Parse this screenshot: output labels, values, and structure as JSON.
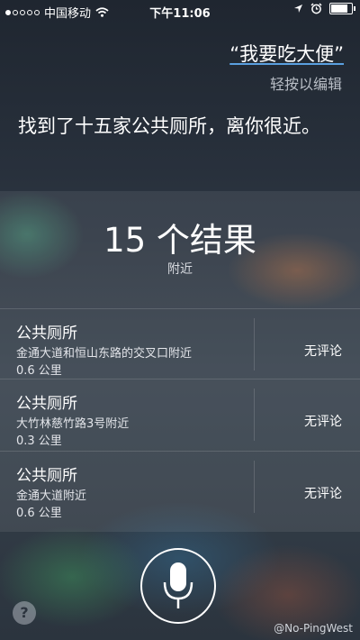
{
  "status_bar": {
    "carrier": "中国移动",
    "time": "下午11:06"
  },
  "siri": {
    "query": "“我要吃大便”",
    "tap_to_edit": "轻按以编辑",
    "answer": "找到了十五家公共厕所，离你很近。"
  },
  "results": {
    "count_label": "15 个结果",
    "subtitle": "附近",
    "items": [
      {
        "name": "公共厕所",
        "address": "金通大道和恒山东路的交叉口附近",
        "distance": "0.6 公里",
        "reviews": "无评论"
      },
      {
        "name": "公共厕所",
        "address": "大竹林慈竹路3号附近",
        "distance": "0.3 公里",
        "reviews": "无评论"
      },
      {
        "name": "公共厕所",
        "address": "金通大道附近",
        "distance": "0.6 公里",
        "reviews": "无评论"
      }
    ]
  },
  "help_label": "?",
  "watermark": "@No-PingWest",
  "icons": {
    "wifi": "wifi-icon",
    "location": "location-arrow-icon",
    "alarm": "alarm-clock-icon",
    "battery": "battery-icon",
    "mic": "microphone-icon",
    "help": "help-icon"
  }
}
